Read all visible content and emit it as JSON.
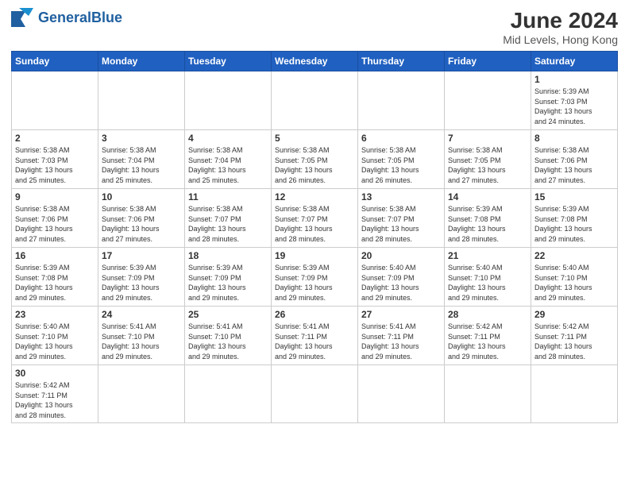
{
  "header": {
    "logo_general": "General",
    "logo_blue": "Blue",
    "title": "June 2024",
    "subtitle": "Mid Levels, Hong Kong"
  },
  "days_of_week": [
    "Sunday",
    "Monday",
    "Tuesday",
    "Wednesday",
    "Thursday",
    "Friday",
    "Saturday"
  ],
  "weeks": [
    [
      {
        "day": "",
        "info": ""
      },
      {
        "day": "",
        "info": ""
      },
      {
        "day": "",
        "info": ""
      },
      {
        "day": "",
        "info": ""
      },
      {
        "day": "",
        "info": ""
      },
      {
        "day": "",
        "info": ""
      },
      {
        "day": "1",
        "info": "Sunrise: 5:39 AM\nSunset: 7:03 PM\nDaylight: 13 hours\nand 24 minutes."
      }
    ],
    [
      {
        "day": "2",
        "info": "Sunrise: 5:38 AM\nSunset: 7:03 PM\nDaylight: 13 hours\nand 25 minutes."
      },
      {
        "day": "3",
        "info": "Sunrise: 5:38 AM\nSunset: 7:04 PM\nDaylight: 13 hours\nand 25 minutes."
      },
      {
        "day": "4",
        "info": "Sunrise: 5:38 AM\nSunset: 7:04 PM\nDaylight: 13 hours\nand 25 minutes."
      },
      {
        "day": "5",
        "info": "Sunrise: 5:38 AM\nSunset: 7:05 PM\nDaylight: 13 hours\nand 26 minutes."
      },
      {
        "day": "6",
        "info": "Sunrise: 5:38 AM\nSunset: 7:05 PM\nDaylight: 13 hours\nand 26 minutes."
      },
      {
        "day": "7",
        "info": "Sunrise: 5:38 AM\nSunset: 7:05 PM\nDaylight: 13 hours\nand 27 minutes."
      },
      {
        "day": "8",
        "info": "Sunrise: 5:38 AM\nSunset: 7:06 PM\nDaylight: 13 hours\nand 27 minutes."
      }
    ],
    [
      {
        "day": "9",
        "info": "Sunrise: 5:38 AM\nSunset: 7:06 PM\nDaylight: 13 hours\nand 27 minutes."
      },
      {
        "day": "10",
        "info": "Sunrise: 5:38 AM\nSunset: 7:06 PM\nDaylight: 13 hours\nand 27 minutes."
      },
      {
        "day": "11",
        "info": "Sunrise: 5:38 AM\nSunset: 7:07 PM\nDaylight: 13 hours\nand 28 minutes."
      },
      {
        "day": "12",
        "info": "Sunrise: 5:38 AM\nSunset: 7:07 PM\nDaylight: 13 hours\nand 28 minutes."
      },
      {
        "day": "13",
        "info": "Sunrise: 5:38 AM\nSunset: 7:07 PM\nDaylight: 13 hours\nand 28 minutes."
      },
      {
        "day": "14",
        "info": "Sunrise: 5:39 AM\nSunset: 7:08 PM\nDaylight: 13 hours\nand 28 minutes."
      },
      {
        "day": "15",
        "info": "Sunrise: 5:39 AM\nSunset: 7:08 PM\nDaylight: 13 hours\nand 29 minutes."
      }
    ],
    [
      {
        "day": "16",
        "info": "Sunrise: 5:39 AM\nSunset: 7:08 PM\nDaylight: 13 hours\nand 29 minutes."
      },
      {
        "day": "17",
        "info": "Sunrise: 5:39 AM\nSunset: 7:09 PM\nDaylight: 13 hours\nand 29 minutes."
      },
      {
        "day": "18",
        "info": "Sunrise: 5:39 AM\nSunset: 7:09 PM\nDaylight: 13 hours\nand 29 minutes."
      },
      {
        "day": "19",
        "info": "Sunrise: 5:39 AM\nSunset: 7:09 PM\nDaylight: 13 hours\nand 29 minutes."
      },
      {
        "day": "20",
        "info": "Sunrise: 5:40 AM\nSunset: 7:09 PM\nDaylight: 13 hours\nand 29 minutes."
      },
      {
        "day": "21",
        "info": "Sunrise: 5:40 AM\nSunset: 7:10 PM\nDaylight: 13 hours\nand 29 minutes."
      },
      {
        "day": "22",
        "info": "Sunrise: 5:40 AM\nSunset: 7:10 PM\nDaylight: 13 hours\nand 29 minutes."
      }
    ],
    [
      {
        "day": "23",
        "info": "Sunrise: 5:40 AM\nSunset: 7:10 PM\nDaylight: 13 hours\nand 29 minutes."
      },
      {
        "day": "24",
        "info": "Sunrise: 5:41 AM\nSunset: 7:10 PM\nDaylight: 13 hours\nand 29 minutes."
      },
      {
        "day": "25",
        "info": "Sunrise: 5:41 AM\nSunset: 7:10 PM\nDaylight: 13 hours\nand 29 minutes."
      },
      {
        "day": "26",
        "info": "Sunrise: 5:41 AM\nSunset: 7:11 PM\nDaylight: 13 hours\nand 29 minutes."
      },
      {
        "day": "27",
        "info": "Sunrise: 5:41 AM\nSunset: 7:11 PM\nDaylight: 13 hours\nand 29 minutes."
      },
      {
        "day": "28",
        "info": "Sunrise: 5:42 AM\nSunset: 7:11 PM\nDaylight: 13 hours\nand 29 minutes."
      },
      {
        "day": "29",
        "info": "Sunrise: 5:42 AM\nSunset: 7:11 PM\nDaylight: 13 hours\nand 28 minutes."
      }
    ],
    [
      {
        "day": "30",
        "info": "Sunrise: 5:42 AM\nSunset: 7:11 PM\nDaylight: 13 hours\nand 28 minutes."
      },
      {
        "day": "",
        "info": ""
      },
      {
        "day": "",
        "info": ""
      },
      {
        "day": "",
        "info": ""
      },
      {
        "day": "",
        "info": ""
      },
      {
        "day": "",
        "info": ""
      },
      {
        "day": "",
        "info": ""
      }
    ]
  ]
}
